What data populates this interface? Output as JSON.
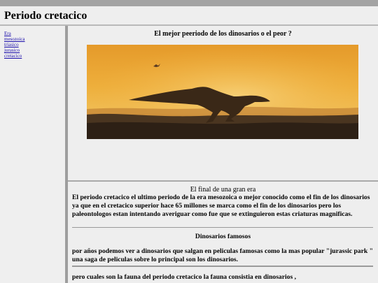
{
  "header": {
    "title": "Periodo cretacico"
  },
  "sidebar": {
    "links": [
      "Era",
      "mesozoica",
      "triasico",
      "jurasico",
      "cretacico"
    ]
  },
  "section1": {
    "title": "El mejor peeriodo de los dinosarios o el peor ?"
  },
  "section2": {
    "title": "El final de una gran era",
    "body": "El periodo cretacico el ultimo periodo de la era mesozoica o mejor conocido como el fin de los dinosarios ya que en el cretacico superior hace 65 millones se marca como el fin de los dinosarios pero los paleontologos estan intentando averiguar como fue que se extinguieron estas criaturas magnificas.",
    "famous_title": "Dinosarios famosos",
    "famous_body": "por años podemos ver a dinosarios que salgan en peliculas famosas como la mas popular \"jurassic park \" una saga de peliculas sobre lo principal son los dinosarios.",
    "last_line": "pero cuales son la fauna del periodo cretacico la fauna consistia en dinosarios ,"
  }
}
